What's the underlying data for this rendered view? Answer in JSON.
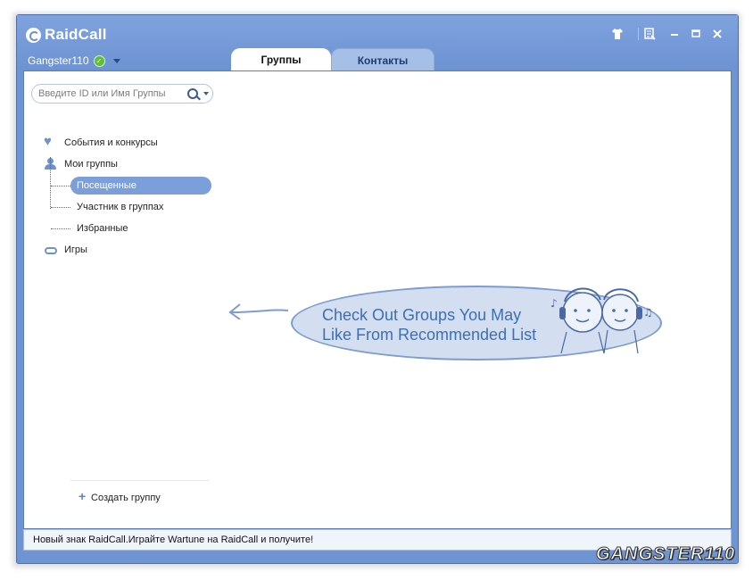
{
  "app": {
    "name": "RaidCall",
    "username": "Gangster110",
    "status": "online"
  },
  "tabs": [
    {
      "label": "Группы",
      "active": true
    },
    {
      "label": "Контакты",
      "active": false
    }
  ],
  "search": {
    "placeholder": "Введите ID или Имя Группы",
    "value": ""
  },
  "sidebar": {
    "items": [
      {
        "label": "События и конкурсы",
        "icon": "heart-icon"
      },
      {
        "label": "Мои группы",
        "icon": "person-icon"
      },
      {
        "label": "Игры",
        "icon": "gamepad-icon"
      }
    ],
    "my_groups_children": [
      {
        "label": "Посещенные",
        "selected": true
      },
      {
        "label": "Участник в группах",
        "selected": false
      },
      {
        "label": "Избранные",
        "selected": false
      }
    ],
    "create_group": "Создать группу"
  },
  "main": {
    "hint_line1": "Check Out Groups You May",
    "hint_line2": "Like From Recommended List"
  },
  "statusbar": {
    "text": "Новый знак RaidCall.Играйте Wartune на RaidCall и получите!"
  },
  "watermark": "GANGSTER110",
  "colors": {
    "titlebar": "#6f94d2",
    "selection": "#7d9fd9",
    "bubble": "#d3def1",
    "bubble_text": "#3c6fb6"
  }
}
